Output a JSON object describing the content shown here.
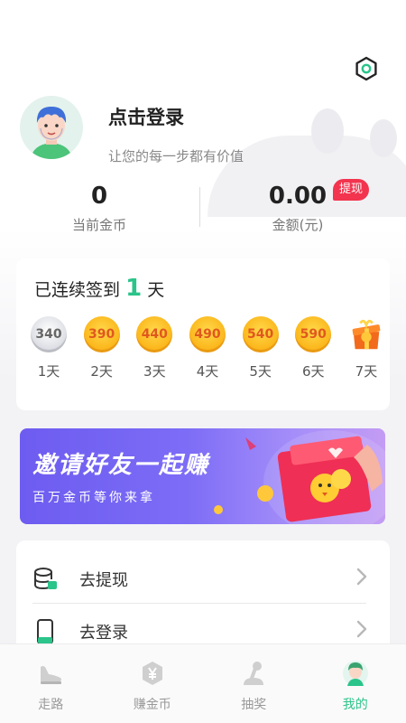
{
  "profile": {
    "title": "点击登录",
    "subtitle": "让您的每一步都有价值"
  },
  "stats": {
    "coins_value": "0",
    "coins_label": "当前金币",
    "amount_value": "0.00",
    "amount_label": "金额(元)",
    "withdraw_badge": "提现"
  },
  "checkin": {
    "prefix": "已连续签到",
    "days": "1",
    "suffix": "天",
    "items": [
      {
        "coin": "340",
        "day": "1天",
        "kind": "silver"
      },
      {
        "coin": "390",
        "day": "2天",
        "kind": "gold"
      },
      {
        "coin": "440",
        "day": "3天",
        "kind": "gold"
      },
      {
        "coin": "490",
        "day": "4天",
        "kind": "gold"
      },
      {
        "coin": "540",
        "day": "5天",
        "kind": "gold"
      },
      {
        "coin": "590",
        "day": "6天",
        "kind": "gold"
      },
      {
        "coin": "",
        "day": "7天",
        "kind": "gift"
      }
    ]
  },
  "banner": {
    "title": "邀请好友一起赚",
    "subtitle": "百万金币等你来拿"
  },
  "menu": [
    {
      "label": "去提现",
      "icon": "wallet-database-icon"
    },
    {
      "label": "去登录",
      "icon": "phone-icon"
    }
  ],
  "tabs": [
    {
      "label": "走路",
      "icon": "shoe-icon"
    },
    {
      "label": "赚金币",
      "icon": "yuan-shield-icon"
    },
    {
      "label": "抽奖",
      "icon": "joystick-icon"
    },
    {
      "label": "我的",
      "icon": "user-avatar-icon"
    }
  ],
  "colors": {
    "accent": "#2bc48a",
    "badge": "#f2344e",
    "coin_gold": "#fbb418",
    "coin_text": "#e0581e",
    "banner_start": "#6d5cf0"
  }
}
